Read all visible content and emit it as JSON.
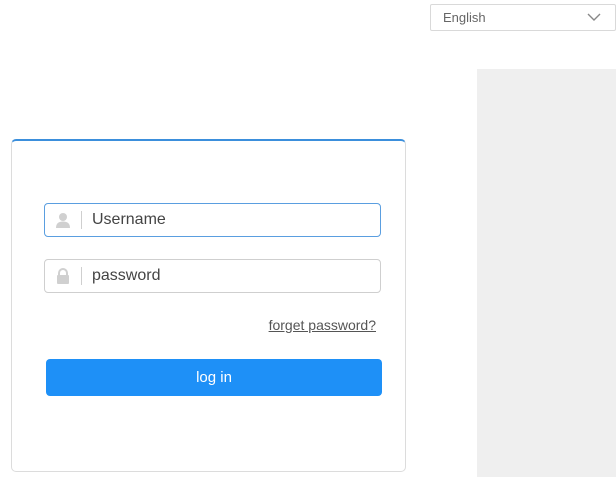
{
  "language_select": {
    "selected": "English",
    "icon": "chevron-down-icon"
  },
  "login_form": {
    "username_placeholder": "Username",
    "username_icon": "user-icon",
    "password_placeholder": "password",
    "password_icon": "lock-icon",
    "forgot_label": "forget password?",
    "login_label": "log in"
  },
  "colors": {
    "accent": "#1e90f7",
    "card_top_border": "#3b8fdc",
    "side_panel": "#efefef"
  }
}
